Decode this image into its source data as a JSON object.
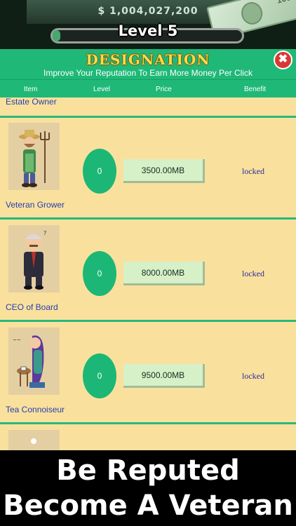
{
  "header": {
    "money": "$ 1,004,027,200",
    "level": "Level 5",
    "level_progress": 0.04,
    "banknote_text": "100"
  },
  "panel": {
    "title": "DESIGNATION",
    "subtitle": "Improve Your Reputation To Earn More Money Per Click",
    "close_icon": "✖"
  },
  "columns": {
    "item": "Item",
    "level": "Level",
    "price": "Price",
    "benefit": "Benefit"
  },
  "list": {
    "partial_top": "Estate Owner",
    "rows": [
      {
        "name": "Veteran Grower",
        "level": "0",
        "price": "3500.00MB",
        "benefit": "locked",
        "icon": "farmer-icon"
      },
      {
        "name": "CEO of Board",
        "level": "0",
        "price": "8000.00MB",
        "benefit": "locked",
        "icon": "ceo-icon"
      },
      {
        "name": "Tea Connoiseur",
        "level": "0",
        "price": "9500.00MB",
        "benefit": "locked",
        "icon": "tea-lady-icon"
      }
    ]
  },
  "caption": {
    "line1": "Be Reputed",
    "line2": "Become A Veteran"
  },
  "colors": {
    "accent_green": "#1fb877",
    "list_bg": "#f9e19d",
    "title_gold": "#f5dc4b",
    "close_red": "#d73a32"
  }
}
